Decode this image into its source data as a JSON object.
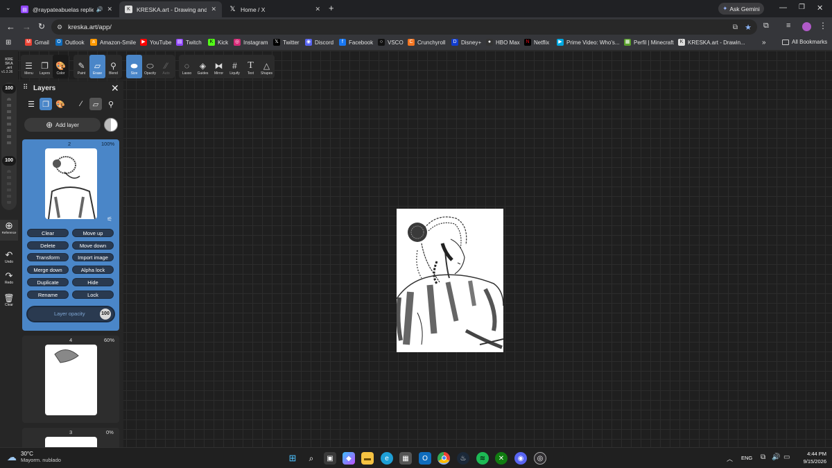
{
  "tabs": [
    {
      "title": "@raypateabuelas replied t",
      "active": false
    },
    {
      "title": "KRESKA.art - Drawing and Paint",
      "active": true
    },
    {
      "title": "Home / X",
      "active": false
    }
  ],
  "ask_gemini": "Ask Gemini",
  "url": "kreska.art/app/",
  "bookmarks": [
    "Gmail",
    "Outlook",
    "Amazon-Smile",
    "YouTube",
    "Twitch",
    "Kick",
    "Instagram",
    "Twitter",
    "Discord",
    "Facebook",
    "VSCO",
    "Crunchyroll",
    "Disney+",
    "HBO Max",
    "Netflix",
    "Prime Video: Who's...",
    "Perfil | Minecraft",
    "KRESKA.art - Drawin..."
  ],
  "all_bookmarks": "All Bookmarks",
  "app": {
    "logo": "KRE SKA .art",
    "version": "v1.3.36",
    "tools": {
      "menu": "Menu",
      "layers": "Layers",
      "color": "Color",
      "paint": "Paint",
      "erase": "Erase",
      "blend": "Blend",
      "size": "Size",
      "opacity": "Opacity",
      "auto": "Auto",
      "lasso": "Lasso",
      "guides": "Guides",
      "mirror": "Mirror",
      "liquify": "Liquify",
      "text": "Text",
      "shapes": "Shapes"
    },
    "rail": {
      "size_value": "100",
      "opacity_value": "100",
      "reference": "Reference",
      "undo": "Undo",
      "redo": "Redo",
      "clear": "Clear"
    },
    "panel": {
      "title": "Layers",
      "add_layer": "Add layer",
      "layers": [
        {
          "name": "2",
          "opacity": "100%"
        },
        {
          "name": "4",
          "opacity": "60%"
        },
        {
          "name": "3",
          "opacity": "0%"
        }
      ],
      "actions": [
        "Clear",
        "Move up",
        "Delete",
        "Move down",
        "Transform",
        "Import image",
        "Merge down",
        "Alpha lock",
        "Duplicate",
        "Hide",
        "Rename",
        "Lock"
      ],
      "layer_opacity_label": "Layer opacity",
      "layer_opacity_value": "100"
    }
  },
  "taskbar": {
    "temperature": "30°C",
    "weather": "Mayorm. nublado",
    "lang": "ENG",
    "time": "4:44 PM",
    "date": "9/15/2026"
  }
}
